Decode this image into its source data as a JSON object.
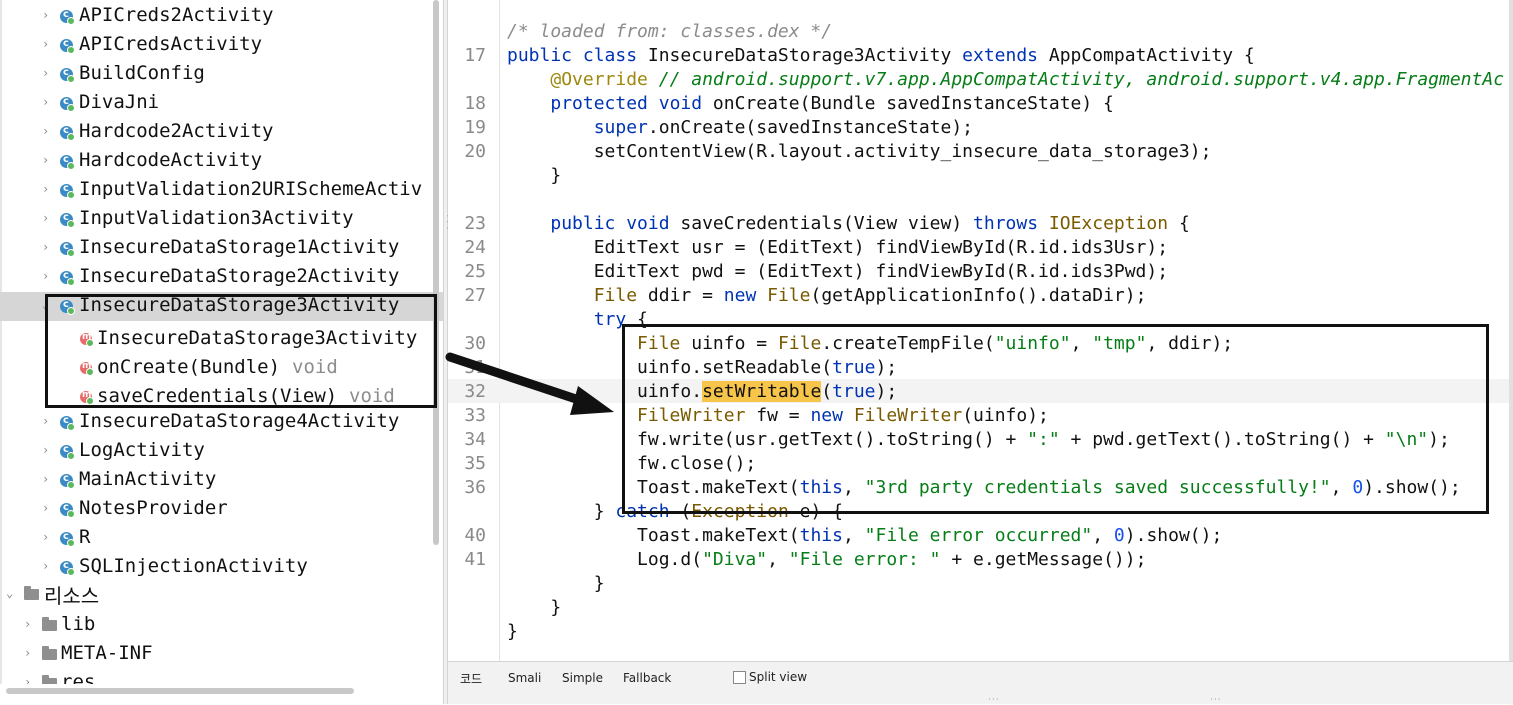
{
  "tree": {
    "items": [
      {
        "label": "APICreds2Activity",
        "kind": "class"
      },
      {
        "label": "APICredsActivity",
        "kind": "class"
      },
      {
        "label": "BuildConfig",
        "kind": "class"
      },
      {
        "label": "DivaJni",
        "kind": "class"
      },
      {
        "label": "Hardcode2Activity",
        "kind": "class"
      },
      {
        "label": "HardcodeActivity",
        "kind": "class"
      },
      {
        "label": "InputValidation2URISchemeActiv",
        "kind": "class"
      },
      {
        "label": "InputValidation3Activity",
        "kind": "class"
      },
      {
        "label": "InsecureDataStorage1Activity",
        "kind": "class"
      },
      {
        "label": "InsecureDataStorage2Activity",
        "kind": "class"
      },
      {
        "label": "InsecureDataStorage3Activity",
        "kind": "class",
        "selected": true,
        "expanded": true
      },
      {
        "label": "InsecureDataStorage3Activity",
        "kind": "method"
      },
      {
        "label": "onCreate(Bundle)",
        "ret": "void",
        "kind": "method"
      },
      {
        "label": "saveCredentials(View)",
        "ret": "void",
        "kind": "method"
      },
      {
        "label": "InsecureDataStorage4Activity",
        "kind": "class"
      },
      {
        "label": "LogActivity",
        "kind": "class"
      },
      {
        "label": "MainActivity",
        "kind": "class"
      },
      {
        "label": "NotesProvider",
        "kind": "class"
      },
      {
        "label": "R",
        "kind": "class"
      },
      {
        "label": "SQLInjectionActivity",
        "kind": "class"
      },
      {
        "label": "리소스",
        "kind": "resroot"
      },
      {
        "label": "lib",
        "kind": "folder"
      },
      {
        "label": "META-INF",
        "kind": "folder"
      },
      {
        "label": "res",
        "kind": "folder"
      }
    ],
    "class_icon_letter": "c",
    "method_icon_letter": "m"
  },
  "editor": {
    "lines": [
      {
        "num": "",
        "html": "<span class='cmt'>/* loaded from: classes.dex */</span>"
      },
      {
        "num": "17",
        "html": "<span class='kw'>public class</span> InsecureDataStorage3Activity <span class='kw'>extends</span> AppCompatActivity {"
      },
      {
        "num": "",
        "html": "    <span class='ann'>@Override</span> <span class='cmt2'>// android.support.v7.app.AppCompatActivity, android.support.v4.app.FragmentAc</span>"
      },
      {
        "num": "18",
        "html": "    <span class='kw'>protected void</span> onCreate(Bundle savedInstanceState) {"
      },
      {
        "num": "19",
        "html": "        <span class='kw'>super</span>.onCreate(savedInstanceState);"
      },
      {
        "num": "20",
        "html": "        setContentView(R.layout.activity_insecure_data_storage3);"
      },
      {
        "num": "",
        "html": "    }"
      },
      {
        "num": "",
        "html": ""
      },
      {
        "num": "23",
        "html": "    <span class='kw'>public void</span> saveCredentials(View view) <span class='kw'>throws</span> <span class='typ'>IOException</span> {"
      },
      {
        "num": "24",
        "html": "        EditText usr = (EditText) findViewById(R.id.ids3Usr);"
      },
      {
        "num": "25",
        "html": "        EditText pwd = (EditText) findViewById(R.id.ids3Pwd);"
      },
      {
        "num": "27",
        "html": "        <span class='typ'>File</span> ddir = <span class='kw'>new</span> <span class='typ'>File</span>(getApplicationInfo().dataDir);"
      },
      {
        "num": "",
        "html": "        <span class='kw'>try</span> {"
      },
      {
        "num": "30",
        "html": "            <span class='typ'>File</span> uinfo = <span class='typ'>File</span>.createTempFile(<span class='str'>\"uinfo\"</span>, <span class='str'>\"tmp\"</span>, ddir);"
      },
      {
        "num": "31",
        "html": "            uinfo.setReadable(<span class='kw'>true</span>);"
      },
      {
        "num": "32",
        "html": "            uinfo.<span class='hl'>setWritable</span>(<span class='kw'>true</span>);",
        "current": true
      },
      {
        "num": "33",
        "html": "            <span class='typ'>FileWriter</span> fw = <span class='kw'>new</span> <span class='typ'>FileWriter</span>(uinfo);"
      },
      {
        "num": "34",
        "html": "            fw.write(usr.getText().toString() + <span class='str'>\":\"</span> + pwd.getText().toString() + <span class='str'>\"\\n\"</span>);"
      },
      {
        "num": "35",
        "html": "            fw.close();"
      },
      {
        "num": "36",
        "html": "            Toast.makeText(<span class='kw'>this</span>, <span class='str'>\"3rd party credentials saved successfully!\"</span>, <span class='num0'>0</span>).show();"
      },
      {
        "num": "",
        "html": "        } <span class='kw'>catch</span> (<span class='typ'>Exception</span> e) {"
      },
      {
        "num": "40",
        "html": "            Toast.makeText(<span class='kw'>this</span>, <span class='str'>\"File error occurred\"</span>, <span class='num0'>0</span>).show();"
      },
      {
        "num": "41",
        "html": "            Log.d(<span class='str'>\"Diva\"</span>, <span class='str'>\"File error: \"</span> + e.getMessage());"
      },
      {
        "num": "",
        "html": "        }"
      },
      {
        "num": "",
        "html": "    }"
      },
      {
        "num": "",
        "html": "}"
      }
    ]
  },
  "bottombar": {
    "tabs": [
      "코드",
      "Smali",
      "Simple",
      "Fallback"
    ],
    "split_view_label": "Split view",
    "split_view_checked": false
  },
  "colors": {
    "keyword": "#0033b3",
    "string": "#067d17",
    "highlight": "#f6c54a",
    "class_icon": "#3a8bc5",
    "method_icon": "#e86a6a"
  }
}
